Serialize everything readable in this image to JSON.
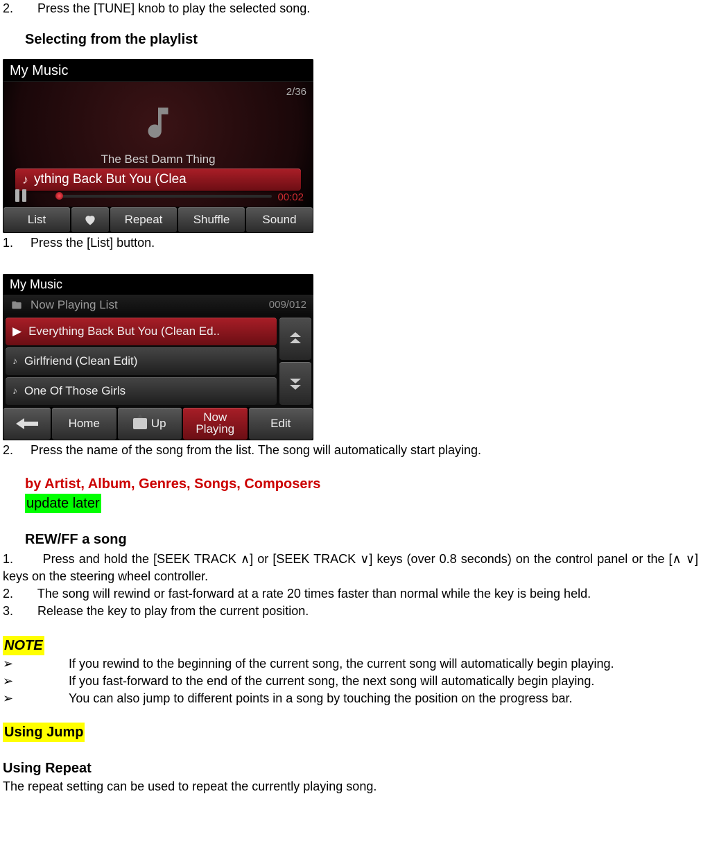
{
  "intro": {
    "step2": "2.",
    "step2_text": "Press the [TUNE] knob to play the selected song."
  },
  "section_playlist_heading": "Selecting from the playlist",
  "ui1": {
    "title": "My Music",
    "counter": "2/36",
    "album": "The Best Damn Thing",
    "song": "ything Back But You (Clea",
    "time": "00:02",
    "buttons": {
      "list": "List",
      "repeat": "Repeat",
      "shuffle": "Shuffle",
      "sound": "Sound"
    }
  },
  "step_after_ui1": {
    "num": "1.",
    "text": "Press the [List] button."
  },
  "ui2": {
    "title": "My Music",
    "subtitle": "Now Playing List",
    "counter": "009/012",
    "rows": {
      "r0": "Everything Back But You (Clean Ed..",
      "r1": "Girlfriend (Clean Edit)",
      "r2": "One Of Those Girls"
    },
    "buttons": {
      "home": "Home",
      "up": "Up",
      "now1": "Now",
      "now2": "Playing",
      "edit": "Edit"
    }
  },
  "step_after_ui2": {
    "num": "2.",
    "text": "Press the name of the song from the list. The song will automatically start playing."
  },
  "red_heading": "by Artist, Album, Genres, Songs, Composers",
  "update_later": "update later",
  "rewff_heading": "REW/FF a song",
  "rewff": {
    "s1n": "1.",
    "s1": "Press and hold the [SEEK TRACK ∧] or [SEEK TRACK ∨] keys (over 0.8 seconds) on the control panel or the [∧ ∨] keys on the steering wheel controller.",
    "s2n": "2.",
    "s2": "The song will rewind or fast-forward at a rate 20 times faster than normal while the key is being held.",
    "s3n": "3.",
    "s3": "Release the key to play from the current position."
  },
  "note_heading": "NOTE",
  "notes": {
    "b1": "If you rewind to the beginning of the current song, the current song will automatically begin playing.",
    "b2": "If you fast-forward to the end of the current song, the next song will automatically begin playing.",
    "b3": "You can also jump to different points in a song by touching the position on the progress bar."
  },
  "using_jump": "Using Jump",
  "using_repeat_heading": "Using Repeat",
  "using_repeat_text": "The repeat setting can be used to repeat the currently playing song."
}
